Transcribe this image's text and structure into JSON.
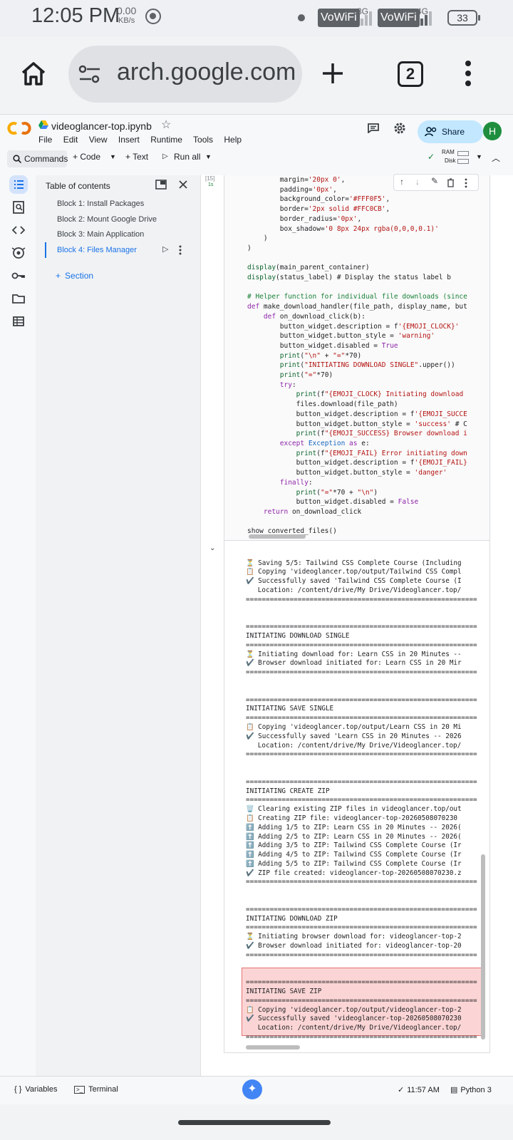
{
  "status_bar": {
    "time": "12:05 PM",
    "speed": "0.00",
    "speed_unit": "KB/s",
    "net1": "VoWiFi",
    "net1_gen": "3G",
    "net2": "VoWiFi",
    "net2_gen": "4G",
    "battery": "33"
  },
  "browser": {
    "url": "arch.google.com",
    "tab_count": "2"
  },
  "colab": {
    "notebook_title": "videoglancer-top.ipynb",
    "menu": [
      "File",
      "Edit",
      "View",
      "Insert",
      "Runtime",
      "Tools",
      "Help"
    ],
    "share_label": "Share",
    "avatar_letter": "H",
    "toolbar": {
      "commands": "Commands",
      "code": "+ Code",
      "text": "+ Text",
      "run_all": "Run all",
      "ram": "RAM",
      "disk": "Disk"
    }
  },
  "toc": {
    "title": "Table of contents",
    "items": [
      {
        "label": "Block 1: Install Packages"
      },
      {
        "label": "Block 2: Mount Google Drive"
      },
      {
        "label": "Block 3: Main Application"
      },
      {
        "label": "Block 4: Files Manager"
      }
    ],
    "add_section": "Section"
  },
  "cell": {
    "exec_count": "[15]",
    "exec_time": "1s",
    "code_lines": [
      "        margin='20px 0',",
      "        padding='0px',",
      "        background_color='#FFF0F5',",
      "        border='2px solid #FFC0CB',",
      "        border_radius='0px',",
      "        box_shadow='0 8px 24px rgba(0,0,0,0.1)'",
      "    )",
      ")",
      "",
      "display(main_parent_container)",
      "display(status_label) # Display the status label b",
      "",
      "# Helper function for individual file downloads (since",
      "def make_download_handler(file_path, display_name, but",
      "    def on_download_click(b):",
      "        button_widget.description = f'{EMOJI_CLOCK}'",
      "        button_widget.button_style = 'warning'",
      "        button_widget.disabled = True",
      "        print(\"\\n\" + \"=\"*70)",
      "        print(\"INITIATING DOWNLOAD SINGLE\".upper())",
      "        print(\"=\"*70)",
      "        try:",
      "            print(f\"{EMOJI_CLOCK} Initiating download",
      "            files.download(file_path)",
      "            button_widget.description = f'{EMOJI_SUCCE",
      "            button_widget.button_style = 'success' # C",
      "            print(f\"{EMOJI_SUCCESS} Browser download i",
      "        except Exception as e:",
      "            print(f\"{EMOJI_FAIL} Error initiating down",
      "            button_widget.description = f'{EMOJI_FAIL}",
      "            button_widget.button_style = 'danger'",
      "        finally:",
      "            print(\"=\"*70 + \"\\n\")",
      "            button_widget.disabled = False",
      "    return on_download_click",
      "",
      "show_converted_files()"
    ]
  },
  "output_lines": [
    "",
    "",
    "⏳ Saving 5/5: Tailwind CSS Complete Course (Including",
    "📋 Copying 'videoglancer.top/output/Tailwind CSS Compl",
    "✔️ Successfully saved 'Tailwind CSS Complete Course (I",
    "   Location: /content/drive/My Drive/Videoglancer.top/",
    "==========================================================",
    "",
    "",
    "==========================================================",
    "INITIATING DOWNLOAD SINGLE",
    "==========================================================",
    "⏳ Initiating download for: Learn CSS in 20 Minutes --",
    "✔️ Browser download initiated for: Learn CSS in 20 Mir",
    "==========================================================",
    "",
    "",
    "==========================================================",
    "INITIATING SAVE SINGLE",
    "==========================================================",
    "📋 Copying 'videoglancer.top/output/Learn CSS in 20 Mi",
    "✔️ Successfully saved 'Learn CSS in 20 Minutes -- 2026",
    "   Location: /content/drive/My Drive/Videoglancer.top/",
    "==========================================================",
    "",
    "",
    "==========================================================",
    "INITIATING CREATE ZIP",
    "==========================================================",
    "🗑️ Clearing existing ZIP files in videoglancer.top/out",
    "📋 Creating ZIP file: videoglancer-top-20260508070230",
    "⬆️ Adding 1/5 to ZIP: Learn CSS in 20 Minutes -- 2026(",
    "⬆️ Adding 2/5 to ZIP: Learn CSS in 20 Minutes -- 2026(",
    "⬆️ Adding 3/5 to ZIP: Tailwind CSS Complete Course (Ir",
    "⬆️ Adding 4/5 to ZIP: Tailwind CSS Complete Course (Ir",
    "⬆️ Adding 5/5 to ZIP: Tailwind CSS Complete Course (Ir",
    "✔️ ZIP file created: videoglancer-top-20260508070230.z",
    "==========================================================",
    "",
    "",
    "==========================================================",
    "INITIATING DOWNLOAD ZIP",
    "==========================================================",
    "⏳ Initiating browser download for: videoglancer-top-2",
    "✔️ Browser download initiated for: videoglancer-top-20",
    "==========================================================",
    "",
    "",
    "==========================================================",
    "INITIATING SAVE ZIP",
    "==========================================================",
    "📋 Copying 'videoglancer.top/output/videoglancer-top-2",
    "✔️ Successfully saved 'videoglancer-top-20260508070230",
    "   Location: /content/drive/My Drive/Videoglancer.top/",
    "=========================================================="
  ],
  "bottom": {
    "variables": "Variables",
    "terminal": "Terminal",
    "last_run": "11:57 AM",
    "runtime": "Python 3"
  }
}
